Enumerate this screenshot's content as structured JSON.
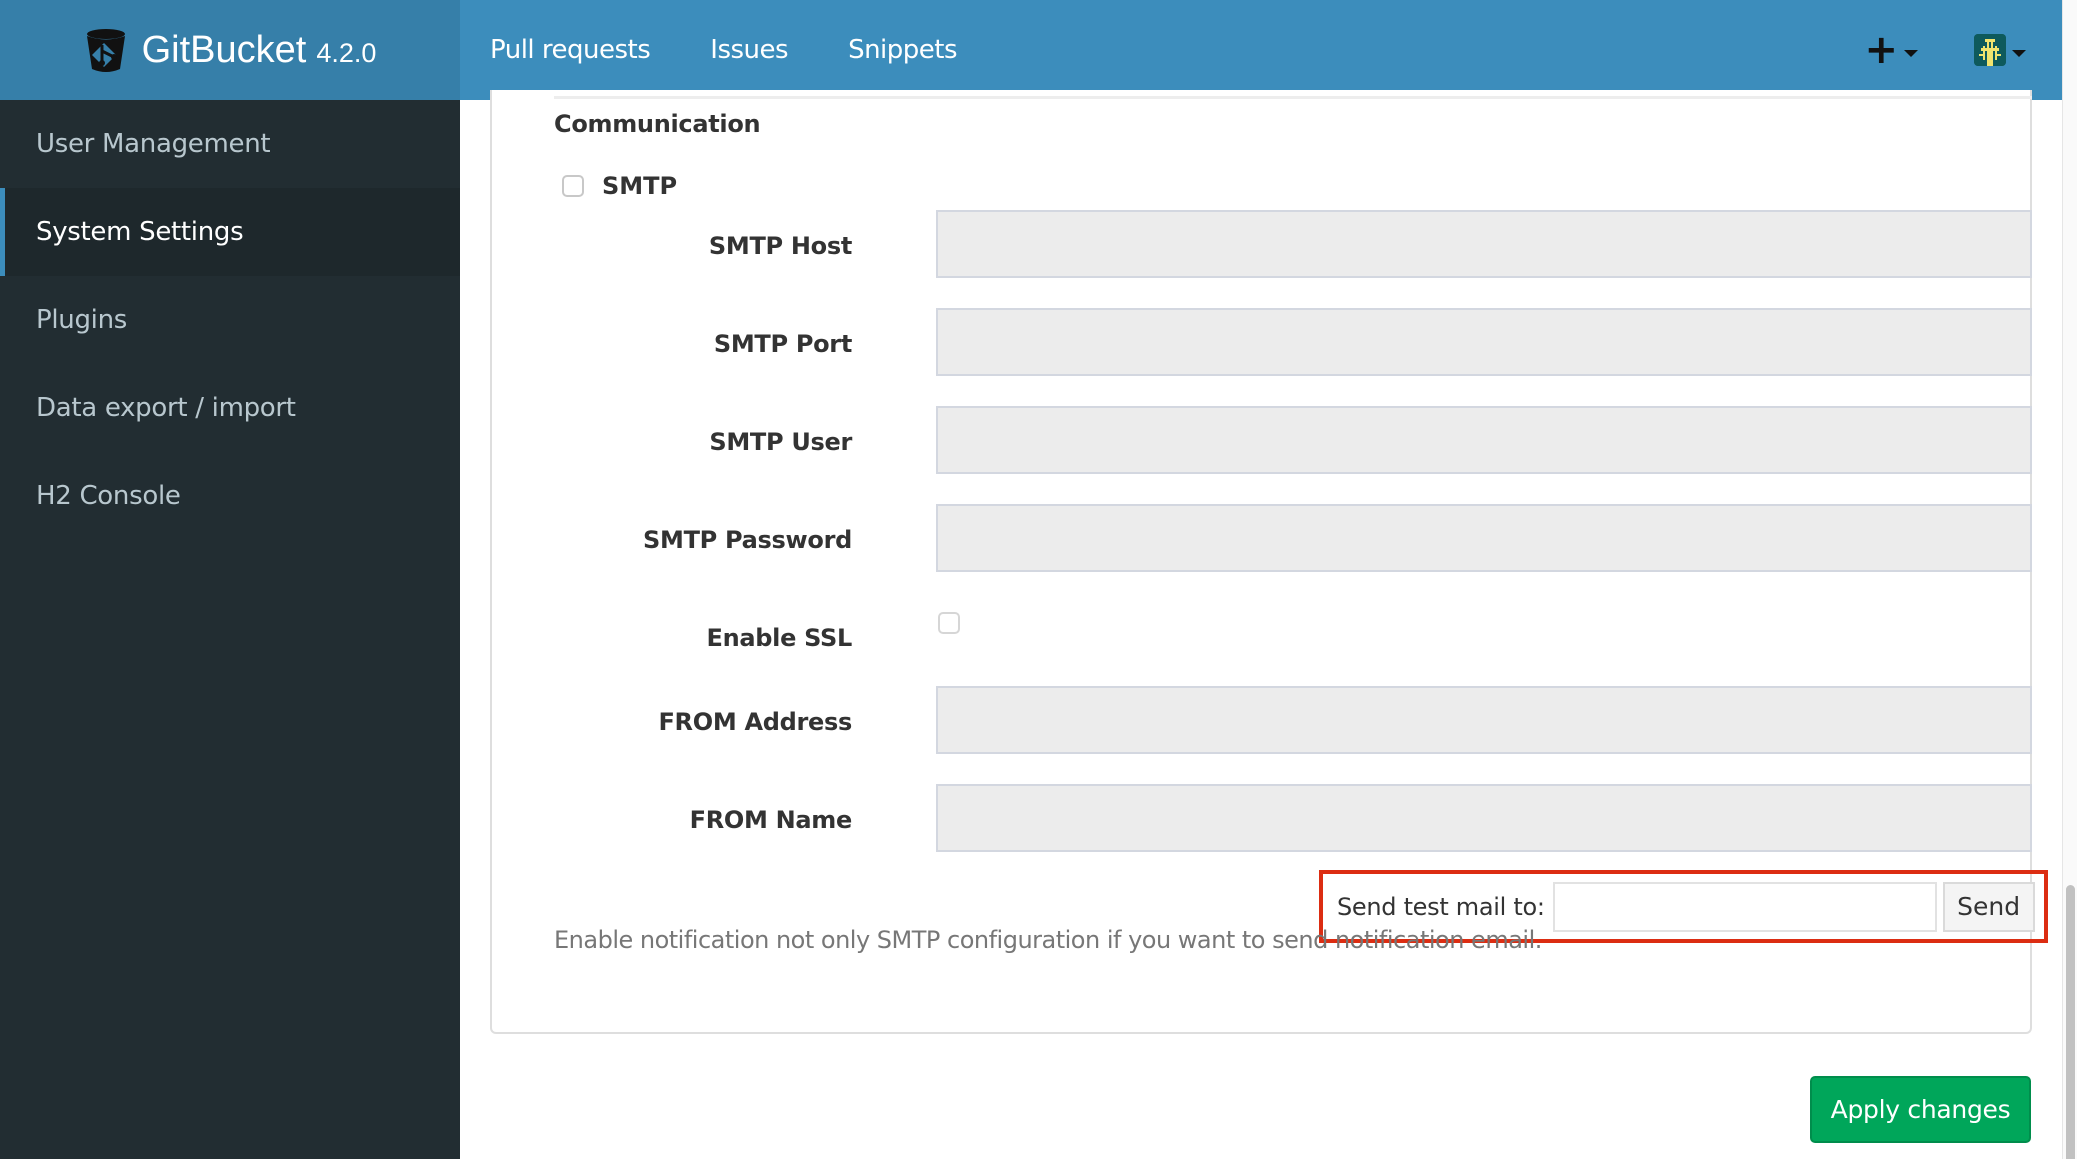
{
  "header": {
    "app_name": "GitBucket",
    "version": "4.2.0",
    "nav": [
      "Pull requests",
      "Issues",
      "Snippets"
    ],
    "create_icon": "+"
  },
  "sidebar": {
    "items": [
      {
        "label": "User Management",
        "active": false
      },
      {
        "label": "System Settings",
        "active": true
      },
      {
        "label": "Plugins",
        "active": false
      },
      {
        "label": "Data export / import",
        "active": false
      },
      {
        "label": "H2 Console",
        "active": false
      }
    ]
  },
  "main": {
    "section_title": "Communication",
    "smtp_toggle": {
      "label": "SMTP",
      "checked": false
    },
    "fields": {
      "smtp_host": {
        "label": "SMTP Host",
        "value": ""
      },
      "smtp_port": {
        "label": "SMTP Port",
        "value": ""
      },
      "smtp_user": {
        "label": "SMTP User",
        "value": ""
      },
      "smtp_password": {
        "label": "SMTP Password",
        "value": ""
      },
      "enable_ssl": {
        "label": "Enable SSL",
        "checked": false
      },
      "from_address": {
        "label": "FROM Address",
        "value": ""
      },
      "from_name": {
        "label": "FROM Name",
        "value": ""
      }
    },
    "test_mail": {
      "label": "Send test mail to:",
      "value": "",
      "button": "Send"
    },
    "hint": "Enable notification not only SMTP configuration if you want to send notification email.",
    "apply_button": "Apply changes"
  },
  "colors": {
    "header": "#3c8dbc",
    "brand": "#367fa9",
    "sidebar": "#222d32",
    "highlight": "#dc2d12",
    "apply": "#00a65a"
  }
}
